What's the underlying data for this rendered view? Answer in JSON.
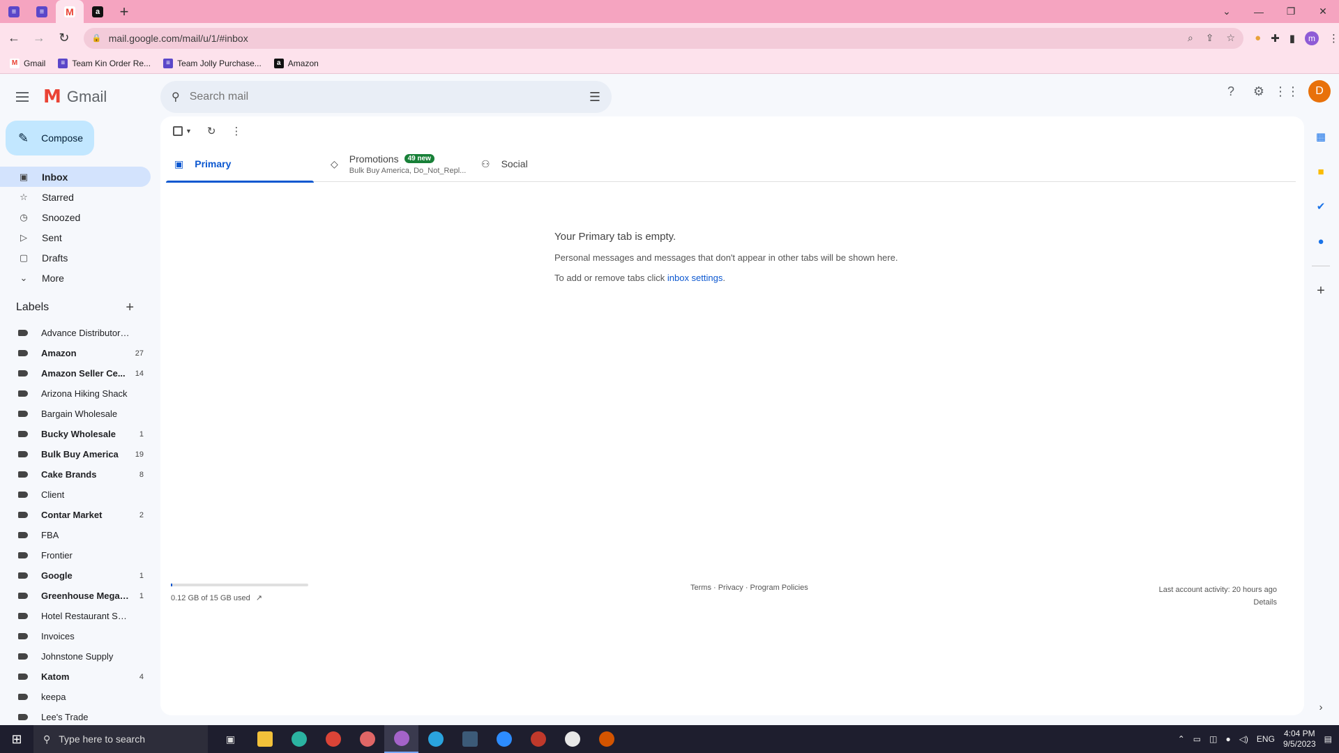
{
  "browser": {
    "tabs": [
      {
        "icon": "task-list-icon",
        "color": "#5b47c9"
      },
      {
        "icon": "task-list-icon",
        "color": "#5b47c9"
      },
      {
        "icon": "gmail-icon",
        "active": true
      },
      {
        "icon": "amazon-icon",
        "color": "#111111"
      }
    ],
    "url": "mail.google.com/mail/u/1/#inbox",
    "profile_initial": "m",
    "bookmarks": [
      {
        "label": "Gmail",
        "icon": "gmail-icon"
      },
      {
        "label": "Team Kin Order Re...",
        "icon": "task-list-icon"
      },
      {
        "label": "Team Jolly Purchase...",
        "icon": "task-list-icon"
      },
      {
        "label": "Amazon",
        "icon": "amazon-icon"
      }
    ]
  },
  "gmail": {
    "app_name": "Gmail",
    "search_placeholder": "Search mail",
    "avatar_initial": "D",
    "compose_label": "Compose",
    "nav": [
      {
        "label": "Inbox",
        "icon": "inbox-icon",
        "active": true
      },
      {
        "label": "Starred",
        "icon": "star-icon"
      },
      {
        "label": "Snoozed",
        "icon": "clock-icon"
      },
      {
        "label": "Sent",
        "icon": "send-icon"
      },
      {
        "label": "Drafts",
        "icon": "draft-icon"
      },
      {
        "label": "More",
        "icon": "chevron-down-icon"
      }
    ],
    "labels_title": "Labels",
    "labels": [
      {
        "name": "Advance Distributors, Inc.",
        "count": "",
        "bold": false
      },
      {
        "name": "Amazon",
        "count": "27",
        "bold": true
      },
      {
        "name": "Amazon Seller Ce...",
        "count": "14",
        "bold": true
      },
      {
        "name": "Arizona Hiking Shack",
        "count": "",
        "bold": false
      },
      {
        "name": "Bargain Wholesale",
        "count": "",
        "bold": false
      },
      {
        "name": "Bucky Wholesale",
        "count": "1",
        "bold": true
      },
      {
        "name": "Bulk Buy America",
        "count": "19",
        "bold": true
      },
      {
        "name": "Cake Brands",
        "count": "8",
        "bold": true
      },
      {
        "name": "Client",
        "count": "",
        "bold": false
      },
      {
        "name": "Contar Market",
        "count": "2",
        "bold": true
      },
      {
        "name": "FBA",
        "count": "",
        "bold": false
      },
      {
        "name": "Frontier",
        "count": "",
        "bold": false
      },
      {
        "name": "Google",
        "count": "1",
        "bold": true
      },
      {
        "name": "Greenhouse Megas...",
        "count": "1",
        "bold": true
      },
      {
        "name": "Hotel Restaurant Supply",
        "count": "",
        "bold": false
      },
      {
        "name": "Invoices",
        "count": "",
        "bold": false
      },
      {
        "name": "Johnstone Supply",
        "count": "",
        "bold": false
      },
      {
        "name": "Katom",
        "count": "4",
        "bold": true
      },
      {
        "name": "keepa",
        "count": "",
        "bold": false
      },
      {
        "name": "Lee's Trade",
        "count": "",
        "bold": false
      }
    ],
    "tabs": {
      "primary": "Primary",
      "promotions": "Promotions",
      "promotions_badge": "49 new",
      "promotions_snippet": "Bulk Buy America, Do_Not_Repl...",
      "social": "Social"
    },
    "empty_state": {
      "title": "Your Primary tab is empty.",
      "line1": "Personal messages and messages that don't appear in other tabs will be shown here.",
      "line2_prefix": "To add or remove tabs click ",
      "line2_link": "inbox settings",
      "line2_suffix": "."
    },
    "footer": {
      "storage": "0.12 GB of 15 GB used",
      "storage_fraction": 0.008,
      "links": "Terms · Privacy · Program Policies",
      "activity": "Last account activity: 20 hours ago",
      "details": "Details"
    }
  },
  "taskbar": {
    "search_placeholder": "Type here to search",
    "language": "ENG",
    "time": "4:04 PM",
    "date": "9/5/2023"
  }
}
